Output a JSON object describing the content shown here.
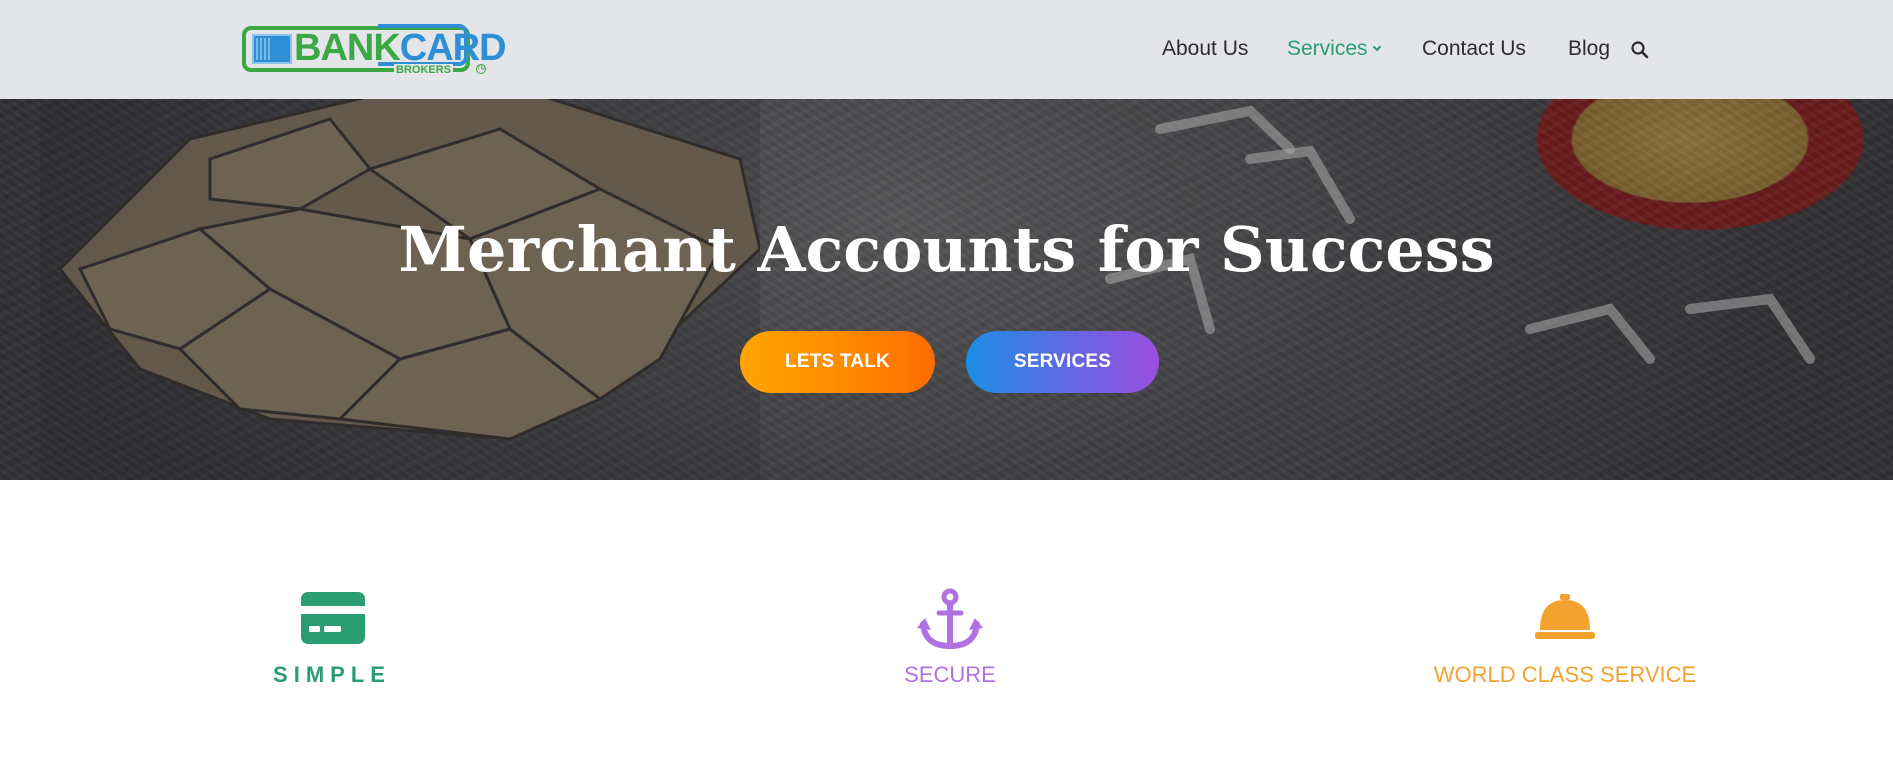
{
  "header": {
    "logo": {
      "word_bank": "BANK",
      "word_card": "CARD",
      "sub": "BROKERS",
      "tm": "TM"
    },
    "nav": [
      {
        "label": "About Us",
        "active": false
      },
      {
        "label": "Services",
        "active": true,
        "has_dropdown": true
      },
      {
        "label": "Contact Us",
        "active": false
      },
      {
        "label": "Blog",
        "active": false
      }
    ],
    "search_icon": "search-icon"
  },
  "hero": {
    "title": "Merchant Accounts for Success",
    "buttons": {
      "primary": "LETS TALK",
      "secondary": "SERVICES"
    }
  },
  "features": [
    {
      "label": "SIMPLE",
      "icon": "credit-card-icon",
      "color": "#2b9d73"
    },
    {
      "label": "SECURE",
      "icon": "anchor-icon",
      "color": "#b072e3"
    },
    {
      "label": "WORLD CLASS SERVICE",
      "icon": "service-bell-icon",
      "color": "#f3a230"
    }
  ],
  "colors": {
    "header_bg": "#e4e5e9",
    "nav_active": "#2b9d73",
    "nav_text": "#2d2d2d",
    "btn_talk_from": "#ffa400",
    "btn_talk_to": "#ff6b00",
    "btn_services_from": "#1a8fe6",
    "btn_services_to": "#9a4fe0"
  }
}
